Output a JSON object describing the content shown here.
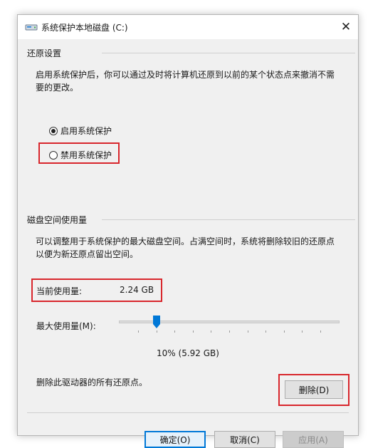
{
  "window": {
    "title": "系统保护本地磁盘 (C:)",
    "close_glyph": "✕"
  },
  "restore": {
    "label": "还原设置",
    "desc_line1": "启用系统保护后，你可以通过及时将计算机还原到以前的某个状态点来撤消不需",
    "desc_line2": "要的更改。",
    "options": [
      {
        "label": "启用系统保护",
        "selected": true
      },
      {
        "label": "禁用系统保护",
        "selected": false
      }
    ]
  },
  "disk": {
    "label": "磁盘空间使用量",
    "desc_line1": "可以调整用于系统保护的最大磁盘空间。占满空间时，系统将删除较旧的还原点",
    "desc_line2": "以便为新还原点留出空间。",
    "current_label": "当前使用量:",
    "current_value": "2.24 GB",
    "max_label": "最大使用量(M):",
    "max_fraction": 0.1,
    "max_value_text": "10% (5.92 GB)",
    "delete_desc": "删除此驱动器的所有还原点。",
    "delete_button": "删除(D)"
  },
  "footer": {
    "ok": "确定(O)",
    "cancel": "取消(C)",
    "apply": "应用(A)"
  },
  "colors": {
    "highlight_red": "#d8262c",
    "accent_blue": "#0078d7"
  }
}
